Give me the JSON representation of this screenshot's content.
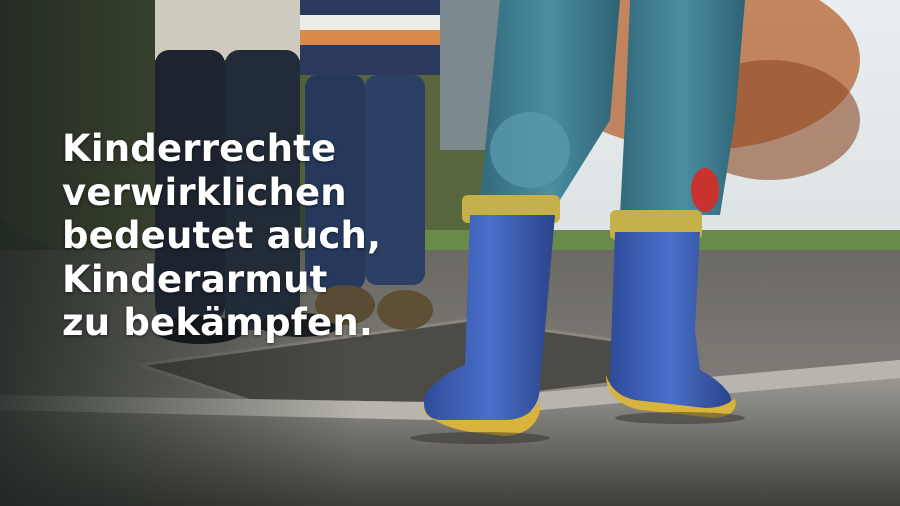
{
  "headline": {
    "lines": [
      "Kinderrechte",
      "verwirklichen",
      "bedeutet auch,",
      "Kinderarmut",
      "zu bekämpfen."
    ]
  },
  "colors": {
    "headline_text": "#ffffff",
    "boot_blue": "#3b5fb8",
    "boot_sole_yellow": "#d8b43c",
    "jeans_blue": "#3f7f93",
    "pavement_grey": "#8e8c85"
  }
}
